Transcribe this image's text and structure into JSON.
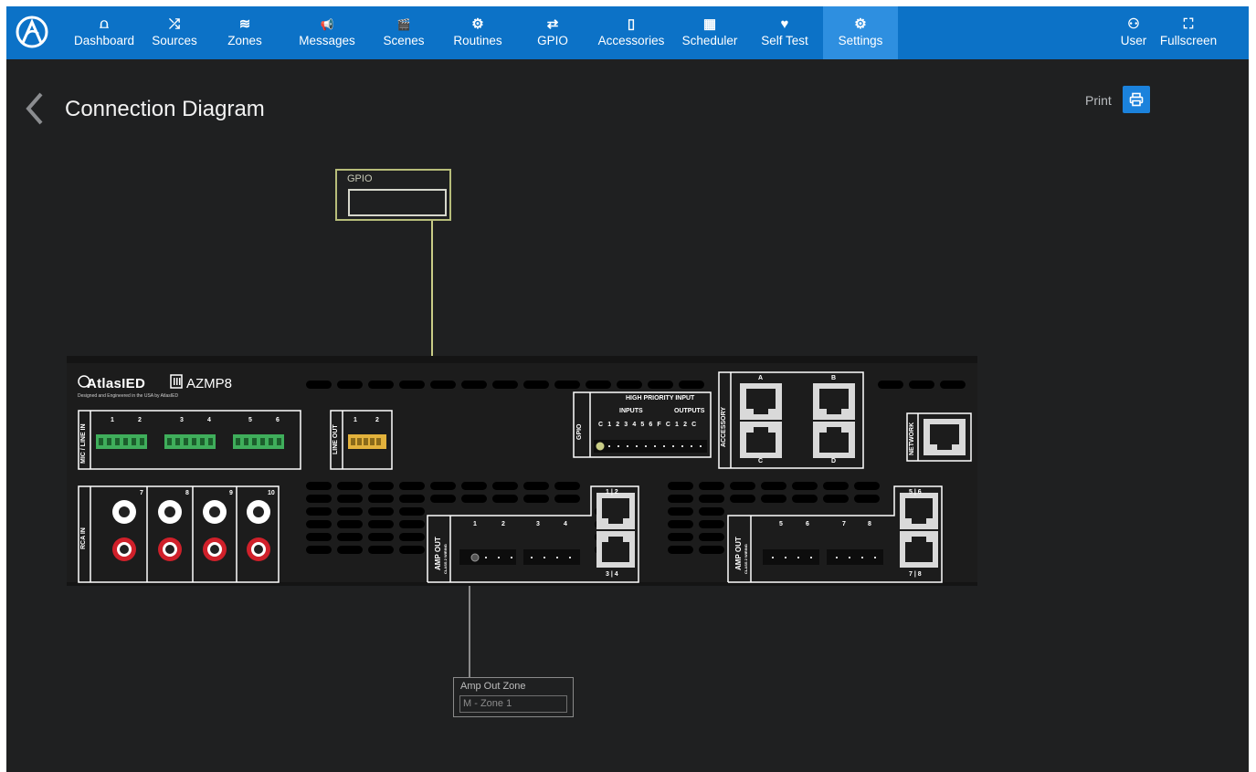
{
  "nav": {
    "items": [
      {
        "label": "Dashboard",
        "icon": "dashboard-icon",
        "glyph": "⩍",
        "active": false
      },
      {
        "label": "Sources",
        "icon": "shuffle-icon",
        "glyph": "⤮",
        "active": false
      },
      {
        "label": "Zones",
        "icon": "layers-icon",
        "glyph": "≋",
        "active": false
      },
      {
        "label": "Messages",
        "icon": "megaphone-icon",
        "glyph": "📢",
        "active": false
      },
      {
        "label": "Scenes",
        "icon": "clapperboard-icon",
        "glyph": "🎬",
        "active": false
      },
      {
        "label": "Routines",
        "icon": "gears-icon",
        "glyph": "⚙",
        "active": false
      },
      {
        "label": "GPIO",
        "icon": "retweet-icon",
        "glyph": "⇄",
        "active": false
      },
      {
        "label": "Accessories",
        "icon": "tablet-icon",
        "glyph": "▯",
        "active": false
      },
      {
        "label": "Scheduler",
        "icon": "calendar-icon",
        "glyph": "▦",
        "active": false
      },
      {
        "label": "Self Test",
        "icon": "heart-check-icon",
        "glyph": "♥",
        "active": false
      },
      {
        "label": "Settings",
        "icon": "gear-icon",
        "glyph": "⚙",
        "active": true
      }
    ],
    "right": [
      {
        "label": "User",
        "icon": "user-icon",
        "glyph": "⚇"
      },
      {
        "label": "Fullscreen",
        "icon": "fullscreen-icon",
        "glyph": "⛶"
      }
    ]
  },
  "page": {
    "title": "Connection Diagram",
    "print_label": "Print"
  },
  "callouts": {
    "gpio": {
      "label": "GPIO",
      "value": ""
    },
    "amp_out": {
      "label": "Amp Out Zone",
      "value": "M - Zone 1"
    }
  },
  "device": {
    "brand": "AtlasIED",
    "model": "AZMP8",
    "tagline": "Designed and Engineered in the USA by AtlasIED",
    "labels": {
      "mic_line_in": "MIC / LINE IN",
      "line_out": "LINE OUT",
      "rca_in": "RCA IN",
      "gpio": "GPIO",
      "high_priority_input": "HIGH PRIORITY INPUT",
      "inputs": "INPUTS",
      "outputs": "OUTPUTS",
      "accessory": "ACCESSORY",
      "network": "NETWORK",
      "amp_out": "AMP OUT",
      "class2": "CLASS 2 WIRING"
    },
    "mic_channels": [
      "1",
      "2",
      "3",
      "4",
      "5",
      "6"
    ],
    "line_out_channels": [
      "1",
      "2"
    ],
    "rca_channels": [
      "7",
      "8",
      "9",
      "10"
    ],
    "gpio_pins": "C 1 2 3 4 5 6 F C 1 2 C",
    "accessory_ports": [
      "A",
      "B",
      "C",
      "D"
    ],
    "amp_ports_left": [
      "1 | 2",
      "3 | 4"
    ],
    "amp_ports_right": [
      "5 | 6",
      "7 | 8"
    ],
    "amp_channels_left": [
      "1",
      "2",
      "3",
      "4"
    ],
    "amp_channels_right": [
      "5",
      "6",
      "7",
      "8"
    ]
  },
  "colors": {
    "nav_bg": "#0c72c7",
    "nav_active": "#2e8fe0",
    "app_bg": "#1f2021",
    "device_bg": "#1c1c1c",
    "terminal_green": "#3fae5b",
    "terminal_yellow": "#e3b23c",
    "rca_red": "#d0202a",
    "gpio_wire": "#c9cd86",
    "amp_wire": "#8a8a8a"
  }
}
